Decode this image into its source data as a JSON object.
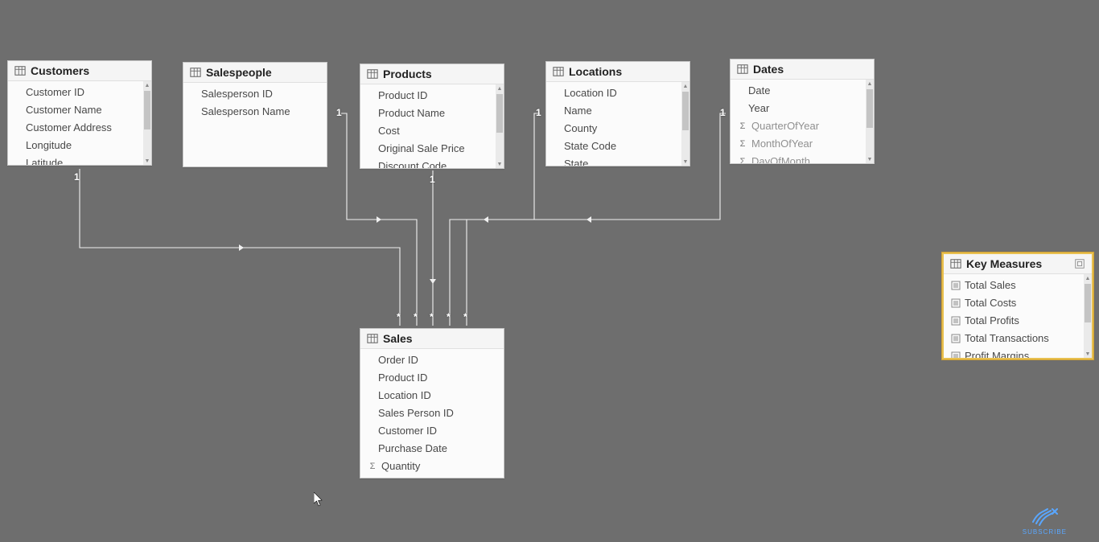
{
  "tables": {
    "customers": {
      "title": "Customers",
      "fields": [
        "Customer ID",
        "Customer Name",
        "Customer Address",
        "Longitude",
        "Latitude"
      ]
    },
    "salespeople": {
      "title": "Salespeople",
      "fields": [
        "Salesperson ID",
        "Salesperson Name"
      ]
    },
    "products": {
      "title": "Products",
      "fields": [
        "Product ID",
        "Product Name",
        "Cost",
        "Original Sale Price",
        "Discount Code"
      ]
    },
    "locations": {
      "title": "Locations",
      "fields": [
        "Location ID",
        "Name",
        "County",
        "State Code",
        "State"
      ]
    },
    "dates": {
      "title": "Dates",
      "fields": [
        "Date",
        "Year",
        "QuarterOfYear",
        "MonthOfYear",
        "DayOfMonth"
      ]
    },
    "sales": {
      "title": "Sales",
      "fields": [
        "Order ID",
        "Product ID",
        "Location ID",
        "Sales Person ID",
        "Customer ID",
        "Purchase Date",
        "Quantity"
      ]
    },
    "keymeasures": {
      "title": "Key Measures",
      "fields": [
        "Total Sales",
        "Total Costs",
        "Total Profits",
        "Total Transactions",
        "Profit Margins"
      ]
    }
  },
  "cardinality": {
    "one": "1",
    "many": "*"
  },
  "subscribe_label": "SUBSCRIBE"
}
